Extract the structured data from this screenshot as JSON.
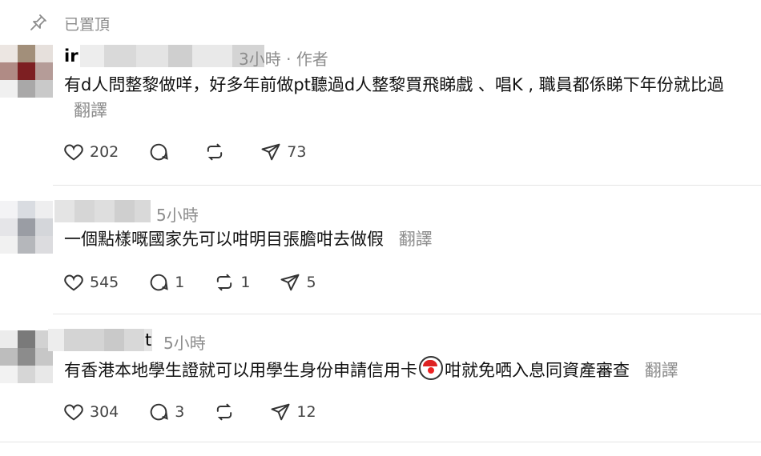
{
  "pinned": {
    "label": "已置頂",
    "icon": "pin-icon"
  },
  "comments": [
    {
      "username": "ir",
      "time": "3小時",
      "separator": "·",
      "author_tag": "作者",
      "text": "有d人問整黎做咩，好多年前做pt聽過d人整黎買飛睇戲 、唱K , 職員都係睇下年份就比過",
      "translate": "翻譯",
      "likes": "202",
      "comments": "",
      "reposts": "",
      "shares": "73"
    },
    {
      "username": "",
      "time": "5小時",
      "text": "一個點樣嘅國家先可以咁明目張膽咁去做假",
      "translate": "翻譯",
      "likes": "545",
      "comments": "1",
      "reposts": "1",
      "shares": "5"
    },
    {
      "username": "t",
      "time": "5小時",
      "text_before_emoji": "有香港本地學生證就可以用學生身份申請信用卡",
      "emoji": "clown-face-emoji",
      "text_after_emoji": "咁就免哂入息同資產審查",
      "translate": "翻譯",
      "likes": "304",
      "comments": "3",
      "reposts": "",
      "shares": "12"
    }
  ],
  "colors": {
    "muted": "#8c8c8c",
    "divider": "#e3e3e3",
    "text": "#111111"
  }
}
